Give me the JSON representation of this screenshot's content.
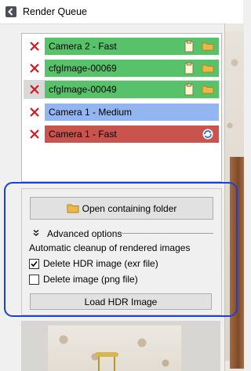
{
  "window": {
    "title": "Render Queue",
    "icon": "app-back-icon"
  },
  "queue": {
    "items": [
      {
        "label": "Camera 2 - Fast",
        "color": "#57c26a",
        "selected": false,
        "icons": [
          "clipboard-icon",
          "folder-icon"
        ]
      },
      {
        "label": "cfgImage-00069",
        "color": "#57c26a",
        "selected": false,
        "icons": [
          "clipboard-icon",
          "folder-icon"
        ]
      },
      {
        "label": "cfgImage-00049",
        "color": "#57c26a",
        "selected": true,
        "icons": [
          "clipboard-icon",
          "folder-icon"
        ]
      },
      {
        "label": "Camera 1 - Medium",
        "color": "#93b5f0",
        "selected": false,
        "icons": []
      },
      {
        "label": "Camera 1 - Fast",
        "color": "#c9544d",
        "selected": false,
        "icons": [
          "refresh-icon"
        ]
      }
    ],
    "remove_icon": "remove-x-icon",
    "remove_color": "#d9181c"
  },
  "options": {
    "open_folder_label": "Open containing folder",
    "advanced_label": "Advanced options",
    "cleanup_label": "Automatic cleanup of rendered images",
    "delete_hdr": {
      "label": "Delete HDR image (exr file)",
      "checked": true
    },
    "delete_png": {
      "label": "Delete image (png file)",
      "checked": false
    },
    "load_hdr_label": "Load HDR Image"
  },
  "annotation": {
    "color": "#1e3fd6"
  }
}
